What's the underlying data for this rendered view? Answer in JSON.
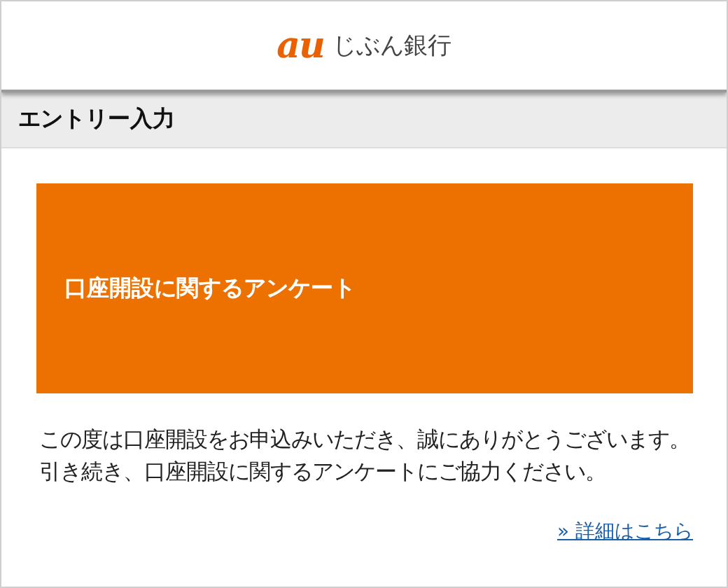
{
  "header": {
    "logo_mark": "au",
    "logo_text": "じぶん銀行"
  },
  "section_title": "エントリー入力",
  "banner": {
    "title": "口座開設に関するアンケート"
  },
  "message": "この度は口座開設をお申込みいただき、誠にありがとうございます。引き続き、口座開設に関するアンケートにご協力ください。",
  "link": {
    "label": "» 詳細はこちら"
  }
}
